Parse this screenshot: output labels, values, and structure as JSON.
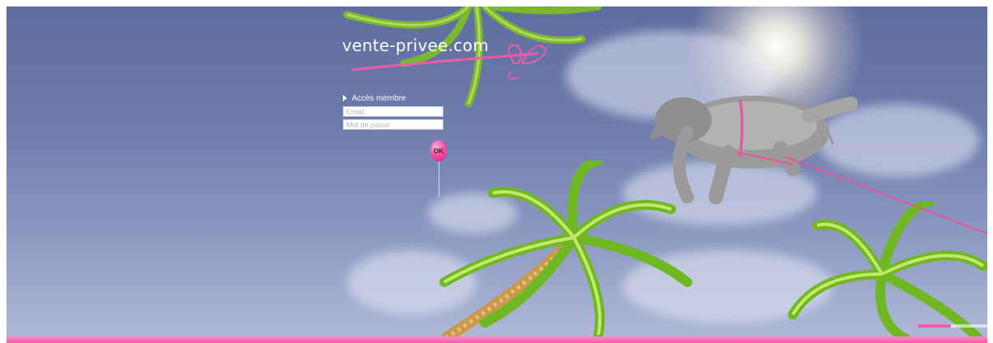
{
  "brand": {
    "name": "vente-privee.com",
    "accent_color": "#f05aa8",
    "logo_icon": "butterfly-icon"
  },
  "login": {
    "title": "Accès membre",
    "email_placeholder": "Email",
    "password_placeholder": "Mot de passe",
    "ok_label": "OK"
  },
  "footer": {
    "links": [
      "",
      "",
      "",
      "",
      "",
      ""
    ]
  },
  "sound_slider": {
    "level": 0.48
  },
  "icons": [
    "play-triangle-icon",
    "butterfly-icon",
    "balloon-icon",
    "elephant-illustration",
    "palm-tree-illustration"
  ]
}
